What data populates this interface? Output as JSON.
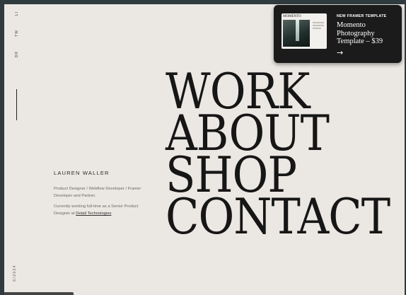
{
  "social": [
    "LI",
    "TW",
    "DR"
  ],
  "date": "6/2024",
  "bio": {
    "name": "LAUREN WALLER",
    "line1": "Product Designer / Webflow Developer / Framer Developer and Partner.",
    "line2_prefix": "Currently working full-time as a Senior Product Designer at",
    "line2_link": "Detail Technologies"
  },
  "nav": [
    "WORK",
    "ABOUT",
    "SHOP",
    "CONTACT"
  ],
  "promo": {
    "label": "NEW FRAMER TEMPLATE",
    "title": "Momento Photography Template – $39",
    "thumb_title": "MOMENTO",
    "arrow": "→"
  }
}
